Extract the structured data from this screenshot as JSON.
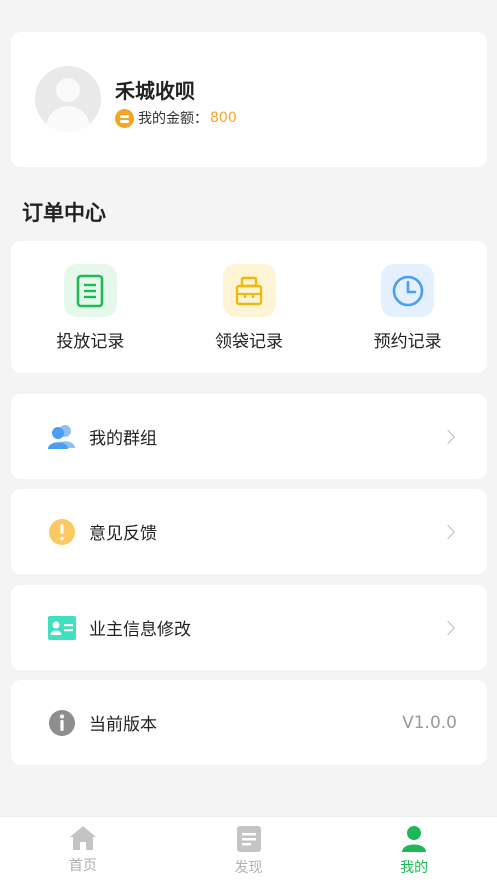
{
  "profile": {
    "name": "禾城收呗",
    "balance_label": "我的金额：",
    "balance_value": "800"
  },
  "orders": {
    "title": "订单中心",
    "items": [
      {
        "label": "投放记录",
        "icon": "document-list-icon",
        "color": "#1db954",
        "bg": "#e6f8ec"
      },
      {
        "label": "领袋记录",
        "icon": "bag-icon",
        "color": "#f5c518",
        "bg": "#fdf4d6"
      },
      {
        "label": "预约记录",
        "icon": "clock-icon",
        "color": "#4a9ff5",
        "bg": "#e4f0fd"
      }
    ]
  },
  "menu": {
    "group": "我的群组",
    "feedback": "意见反馈",
    "owner_info": "业主信息修改",
    "version_label": "当前版本",
    "version_value": "V1.0.0"
  },
  "tabbar": {
    "home": "首页",
    "discover": "发现",
    "mine": "我的"
  },
  "colors": {
    "accent": "#1db954",
    "coin": "#f5a623"
  }
}
